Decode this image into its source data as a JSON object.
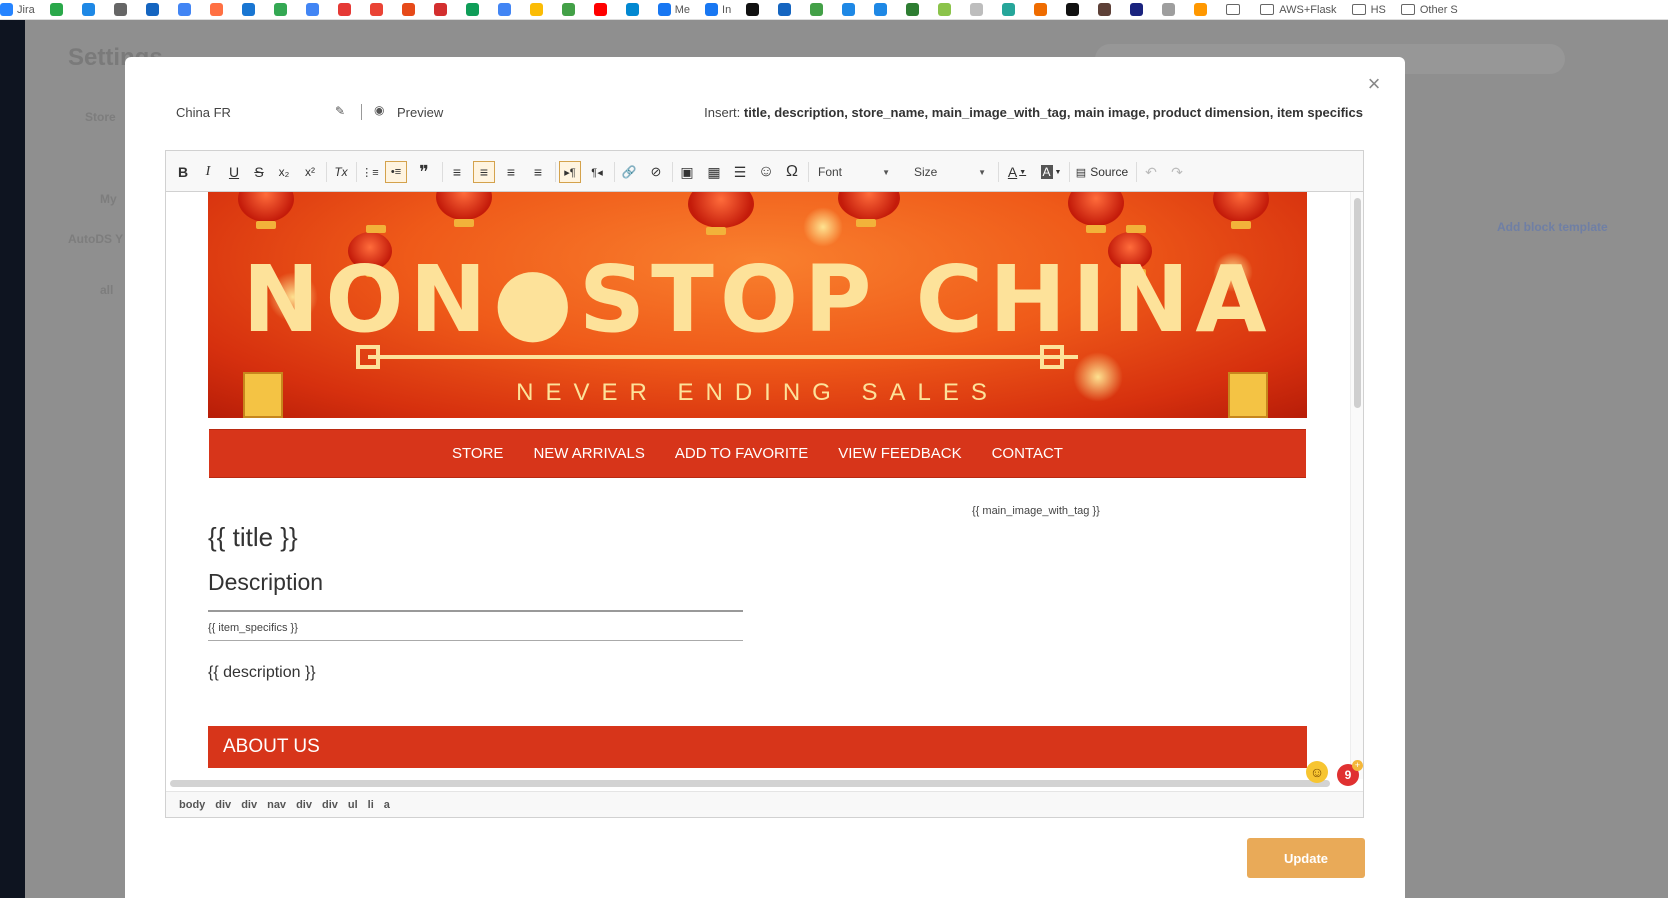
{
  "bookmarks": [
    {
      "label": "Jira",
      "color": "#2684ff"
    },
    {
      "label": "",
      "color": "#2aa84a"
    },
    {
      "label": "",
      "color": "#1e88e5"
    },
    {
      "label": "",
      "color": "#666666"
    },
    {
      "label": "",
      "color": "#1565c0"
    },
    {
      "label": "",
      "color": "#4285f4"
    },
    {
      "label": "",
      "color": "#ff7043"
    },
    {
      "label": "",
      "color": "#1976d2"
    },
    {
      "label": "",
      "color": "#34a853"
    },
    {
      "label": "",
      "color": "#4285f4"
    },
    {
      "label": "",
      "color": "#e53935"
    },
    {
      "label": "",
      "color": "#ea4335"
    },
    {
      "label": "",
      "color": "#e64a19"
    },
    {
      "label": "",
      "color": "#d32f2f"
    },
    {
      "label": "",
      "color": "#0f9d58"
    },
    {
      "label": "",
      "color": "#4285f4"
    },
    {
      "label": "",
      "color": "#fbbc05"
    },
    {
      "label": "",
      "color": "#43a047"
    },
    {
      "label": "",
      "color": "#ff0000"
    },
    {
      "label": "",
      "color": "#0288d1"
    },
    {
      "label": "Me",
      "color": "#1877f2"
    },
    {
      "label": "In",
      "color": "#1877f2"
    },
    {
      "label": "",
      "color": "#111111"
    },
    {
      "label": "",
      "color": "#1565c0"
    },
    {
      "label": "",
      "color": "#43a047"
    },
    {
      "label": "",
      "color": "#1e88e5"
    },
    {
      "label": "",
      "color": "#1e88e5"
    },
    {
      "label": "",
      "color": "#2e7d32"
    },
    {
      "label": "",
      "color": "#8bc34a"
    },
    {
      "label": "",
      "color": "#bdbdbd"
    },
    {
      "label": "",
      "color": "#26a69a"
    },
    {
      "label": "",
      "color": "#ef6c00"
    },
    {
      "label": "",
      "color": "#111111"
    },
    {
      "label": "",
      "color": "#5d4037"
    },
    {
      "label": "",
      "color": "#1a237e"
    },
    {
      "label": "",
      "color": "#9e9e9e"
    },
    {
      "label": "",
      "color": "#ff9800"
    }
  ],
  "bookmark_folders": [
    "",
    "AWS+Flask",
    "HS",
    "Other S"
  ],
  "background": {
    "title": "Settings",
    "add_link": "Add block template",
    "left_items": [
      "Store",
      "My",
      "AutoDS Y",
      "all"
    ]
  },
  "modal": {
    "template_name": "China FR",
    "preview_label": "Preview",
    "insert_label": "Insert:",
    "insert_fields": "title, description, store_name, main_image_with_tag, main image, product dimension, item specifics",
    "close_label": "×",
    "update_label": "Update"
  },
  "toolbar": {
    "bold": "B",
    "italic": "I",
    "underline": "U",
    "strike": "S",
    "subscript": "x₂",
    "superscript": "x²",
    "remove_format": "Tx",
    "numbered_list": "⋮≡",
    "bulleted_list": "•≡",
    "blockquote": "❞",
    "align_left": "≡",
    "align_center": "≡",
    "align_right": "≡",
    "justify": "≡",
    "ltr": "▸¶",
    "rtl": "¶◂",
    "link": "🔗",
    "unlink": "⊘",
    "image": "▣",
    "table": "▦",
    "hr": "☰",
    "smiley": "☺",
    "special_char": "Ω",
    "font_label": "Font",
    "size_label": "Size",
    "text_color": "A",
    "bg_color": "A",
    "source_label": "Source",
    "undo": "↶",
    "redo": "↷"
  },
  "content": {
    "banner_title": "NON●STOP CHINA",
    "banner_subtitle": "NEVER ENDING SALES",
    "nav_items": [
      "STORE",
      "NEW ARRIVALS",
      "ADD TO FAVORITE",
      "VIEW FEEDBACK",
      "CONTACT"
    ],
    "main_image_placeholder": "{{ main_image_with_tag }}",
    "title_placeholder": "{{ title }}",
    "description_heading": "Description",
    "item_specifics_placeholder": "{{ item_specifics }}",
    "description_placeholder": "{{ description }}",
    "about_heading": "ABOUT US"
  },
  "pathbar": [
    "body",
    "div",
    "div",
    "nav",
    "div",
    "div",
    "ul",
    "li",
    "a"
  ],
  "badges": {
    "emoji": "☺",
    "notification_count": "9",
    "plus": "+"
  }
}
